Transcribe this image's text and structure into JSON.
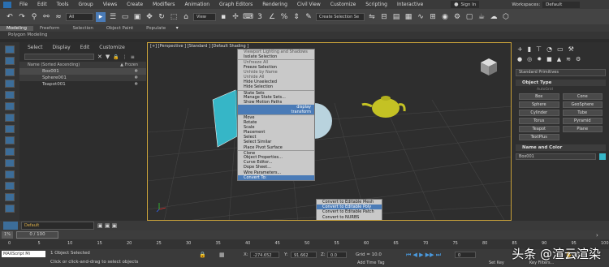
{
  "menu": [
    "File",
    "Edit",
    "Tools",
    "Group",
    "Views",
    "Create",
    "Modifiers",
    "Animation",
    "Graph Editors",
    "Rendering",
    "Civil View",
    "Customize",
    "Scripting",
    "Interactive"
  ],
  "signin": "Sign In",
  "workspaces_label": "Workspaces:",
  "workspace": "Default",
  "toolbar": {
    "filter": "All",
    "view": "View",
    "selection_set": "Create Selection Se"
  },
  "ribbon": {
    "tabs": [
      "Modeling",
      "Freeform",
      "Selection",
      "Object Paint",
      "Populate"
    ],
    "subtitle": "Polygon Modeling"
  },
  "explorer": {
    "menu": [
      "Select",
      "Display",
      "Edit",
      "Customize"
    ],
    "header_name": "Name (Sorted Ascending)",
    "header_frozen": "▲ Frozen",
    "rows": [
      "Box001",
      "Sphere001",
      "Teapot001"
    ]
  },
  "viewport": {
    "label": "[+] [Perspective ] [Standard ] [Default Shading ]"
  },
  "context_menu": [
    {
      "t": "Viewport Lighting and Shadows",
      "c": "grey"
    },
    {
      "t": "Isolate Selection",
      "c": ""
    },
    {
      "t": "Unfreeze All",
      "c": "grey sep"
    },
    {
      "t": "Freeze Selection",
      "c": ""
    },
    {
      "t": "Unhide by Name",
      "c": "grey"
    },
    {
      "t": "Unhide All",
      "c": "grey"
    },
    {
      "t": "Hide Unselected",
      "c": ""
    },
    {
      "t": "Hide Selection",
      "c": ""
    },
    {
      "t": "State Sets",
      "c": "sep"
    },
    {
      "t": "Manage State Sets...",
      "c": ""
    },
    {
      "t": "Show Motion Paths",
      "c": ""
    },
    {
      "t": "display",
      "c": "qm"
    },
    {
      "t": "transform",
      "c": "qm"
    },
    {
      "t": "Move",
      "c": "sep"
    },
    {
      "t": "Rotate",
      "c": ""
    },
    {
      "t": "Scale",
      "c": ""
    },
    {
      "t": "Placement",
      "c": ""
    },
    {
      "t": "Select",
      "c": ""
    },
    {
      "t": "Select Similar",
      "c": ""
    },
    {
      "t": "Place Pivot Surface",
      "c": ""
    },
    {
      "t": "Clone",
      "c": "sep"
    },
    {
      "t": "Object Properties...",
      "c": ""
    },
    {
      "t": "Curve Editor...",
      "c": ""
    },
    {
      "t": "Dope Sheet...",
      "c": ""
    },
    {
      "t": "Wire Parameters...",
      "c": ""
    },
    {
      "t": "Convert To:",
      "c": "hl"
    }
  ],
  "submenu": [
    "Convert to Editable Mesh",
    "Convert to Editable Poly",
    "Convert to Editable Patch",
    "Convert to NURBS"
  ],
  "submenu_selected": 1,
  "right_panel": {
    "dropdown": "Standard Primitives",
    "object_type": "Object Type",
    "autogrid": "AutoGrid",
    "buttons": [
      "Box",
      "Cone",
      "Sphere",
      "GeoSphere",
      "Cylinder",
      "Tube",
      "Torus",
      "Pyramid",
      "Teapot",
      "Plane",
      "TextPlus"
    ],
    "name_color": "Name and Color",
    "object_name": "Box001"
  },
  "layer": "Default",
  "time": {
    "frame": "0 / 100",
    "ticks": [
      "0",
      "5",
      "10",
      "15",
      "20",
      "25",
      "30",
      "35",
      "40",
      "45",
      "50",
      "55",
      "60",
      "65",
      "70",
      "75",
      "80",
      "85",
      "90",
      "95",
      "100"
    ]
  },
  "status": {
    "maxscript": "MAXScript Mi",
    "selected": "1 Object Selected",
    "prompt": "Click or click-and-drag to select objects",
    "x_label": "X:",
    "x": "-274.652",
    "y_label": "Y:",
    "y": "91.662",
    "z_label": "Z:",
    "z": "0.0",
    "grid": "Grid = 10.0",
    "addtime": "Add Time Tag",
    "setkey": "Set Key",
    "keyfilters": "Key Filters...",
    "frame_field": "0"
  },
  "watermark": "头条 @渲云渲染",
  "colors": {
    "selection_orange": "#c9a23a",
    "accent_blue": "#4a7bb7",
    "box_cyan": "#36b6c7",
    "teapot_yellow": "#c4c224"
  }
}
